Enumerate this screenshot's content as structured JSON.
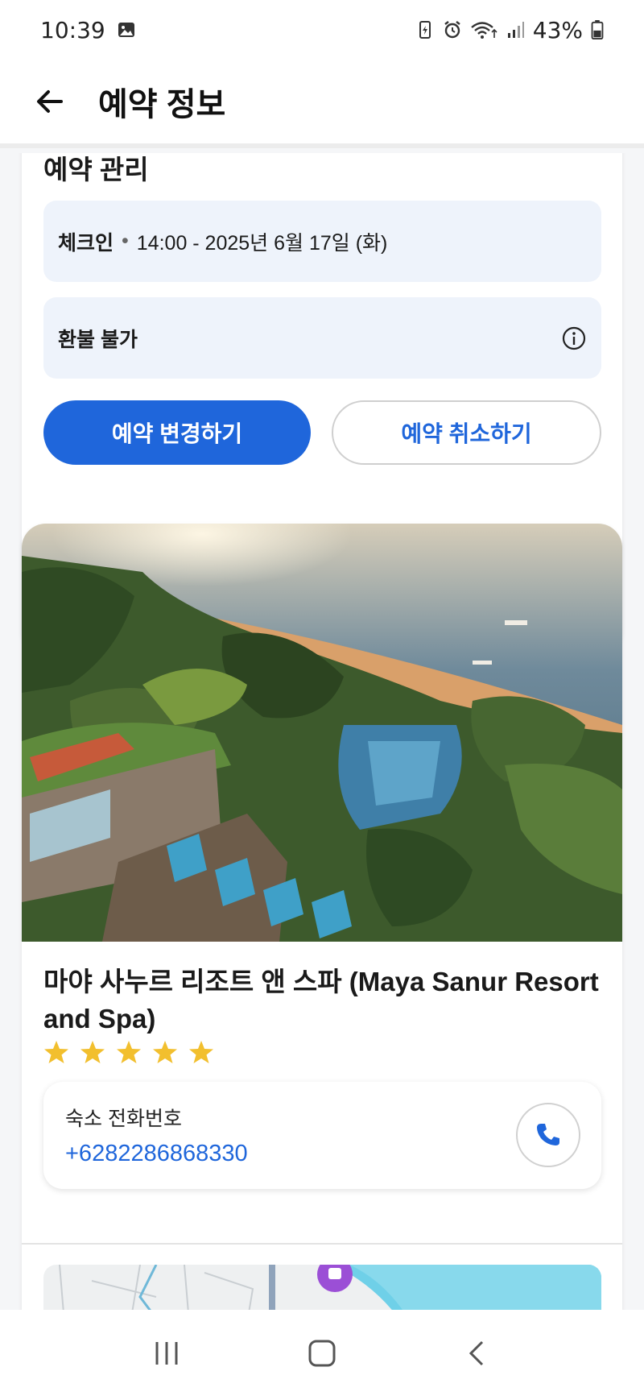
{
  "status_bar": {
    "time": "10:39",
    "battery": "43%",
    "icons": [
      "image-icon",
      "battery-saver-icon",
      "alarm-icon",
      "wifi-icon",
      "signal-icon",
      "battery-icon"
    ]
  },
  "app_bar": {
    "title": "예약 정보",
    "back_icon": "arrow-left-icon"
  },
  "booking_management": {
    "title": "예약 관리",
    "checkin_label": "체크인",
    "checkin_value": "14:00 - 2025년 6월 17일 (화)",
    "refund_label": "환불 불가",
    "change_button": "예약 변경하기",
    "cancel_button": "예약 취소하기"
  },
  "hotel": {
    "name": "마야 사누르 리조트 앤 스파 (Maya Sanur Resort and Spa)",
    "rating": 5,
    "phone_label": "숙소 전화번호",
    "phone_number": "+6282286868330"
  },
  "colors": {
    "accent": "#1f66db",
    "info_bg": "#eef3fb",
    "star": "#f2bf2e"
  }
}
